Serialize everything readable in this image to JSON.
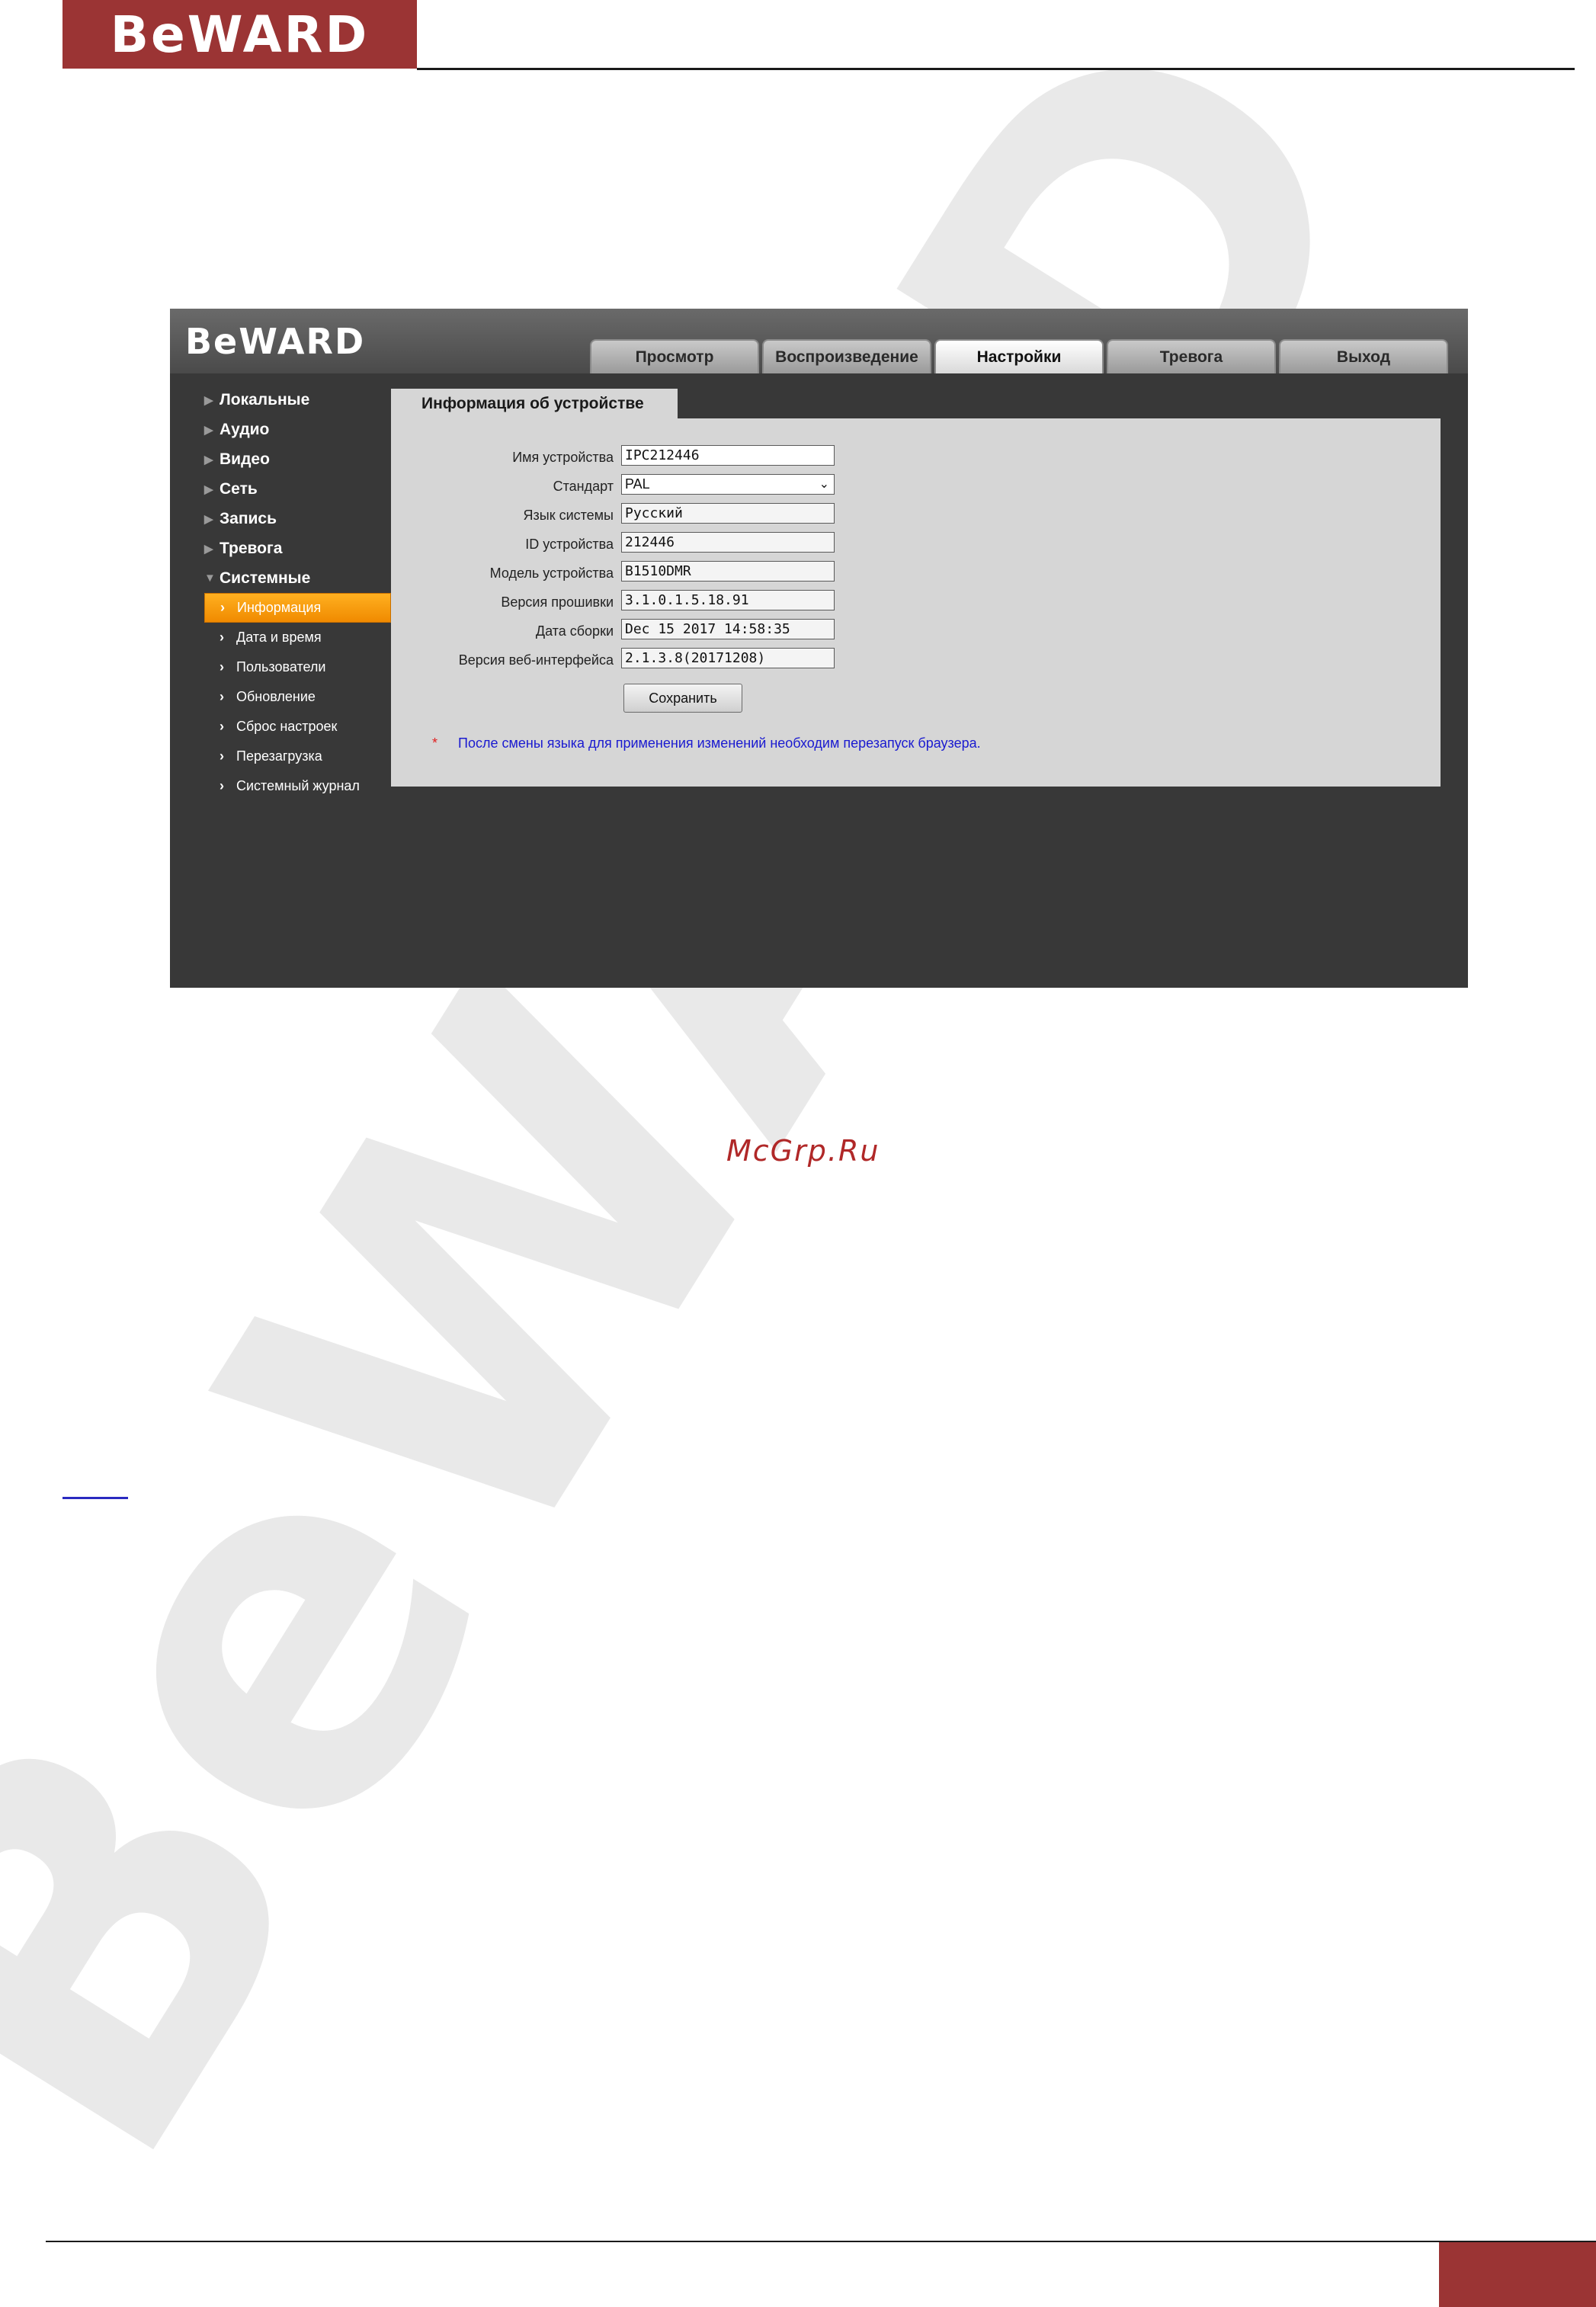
{
  "page_logo": "BeWARD",
  "ui_logo": "BeWARD",
  "watermark_text": "BeWARD",
  "tabs": [
    {
      "label": "Просмотр"
    },
    {
      "label": "Воспроизведение"
    },
    {
      "label": "Настройки"
    },
    {
      "label": "Тревога"
    },
    {
      "label": "Выход"
    }
  ],
  "active_tab": "Настройки",
  "sidebar": {
    "items": [
      {
        "label": "Локальные"
      },
      {
        "label": "Аудио"
      },
      {
        "label": "Видео"
      },
      {
        "label": "Сеть"
      },
      {
        "label": "Запись"
      },
      {
        "label": "Тревога"
      },
      {
        "label": "Системные"
      }
    ],
    "subitems": [
      {
        "label": "Информация"
      },
      {
        "label": "Дата и время"
      },
      {
        "label": "Пользователи"
      },
      {
        "label": "Обновление"
      },
      {
        "label": "Сброс настроек"
      },
      {
        "label": "Перезагрузка"
      },
      {
        "label": "Системный журнал"
      }
    ]
  },
  "panel": {
    "title": "Информация об устройстве",
    "fields": {
      "device_name": {
        "label": "Имя устройства",
        "value": "IPC212446"
      },
      "standard": {
        "label": "Стандарт",
        "value": "PAL"
      },
      "language": {
        "label": "Язык системы",
        "value": "Русский"
      },
      "device_id": {
        "label": "ID устройства",
        "value": "212446"
      },
      "model": {
        "label": "Модель устройства",
        "value": "B1510DMR"
      },
      "firmware": {
        "label": "Версия прошивки",
        "value": "3.1.0.1.5.18.91"
      },
      "build_date": {
        "label": "Дата сборки",
        "value": "Dec 15 2017  14:58:35"
      },
      "web_version": {
        "label": "Версия веб-интерфейса",
        "value": "2.1.3.8(20171208)"
      }
    },
    "save_label": "Сохранить",
    "note_mark": "*",
    "note": "После смены языка для применения изменений необходим перезапуск браузера."
  },
  "site_mark": "McGrp.Ru",
  "colors": {
    "brand": "#9b3434",
    "active_menu": "#f59a10",
    "note_text": "#1a1ad0",
    "ui_background": "#383838",
    "panel_background": "#d6d6d6"
  }
}
